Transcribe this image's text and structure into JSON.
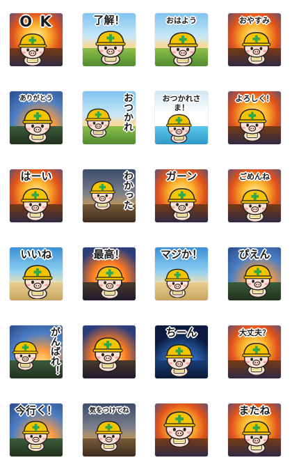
{
  "stickers": [
    {
      "caption": "O K",
      "scene": "fire"
    },
    {
      "caption": "了解！",
      "scene": "field"
    },
    {
      "caption": "おはよう",
      "scene": "field"
    },
    {
      "caption": "おやすみ",
      "scene": "fire"
    },
    {
      "caption": "ありがとう",
      "scene": "sky"
    },
    {
      "caption": "おつかれ",
      "scene": "field"
    },
    {
      "caption": "おつかれさま！",
      "scene": "pool"
    },
    {
      "caption": "よろしく！",
      "scene": "fire"
    },
    {
      "caption": "はーい",
      "scene": "fire"
    },
    {
      "caption": "わかった",
      "scene": "village"
    },
    {
      "caption": "ガーン",
      "scene": "fire"
    },
    {
      "caption": "ごめんね",
      "scene": "fire"
    },
    {
      "caption": "いいね",
      "scene": "beach"
    },
    {
      "caption": "最高！",
      "scene": "blast"
    },
    {
      "caption": "マジか！",
      "scene": "beach"
    },
    {
      "caption": "ぴえん",
      "scene": "sky"
    },
    {
      "caption": "がんばれ！",
      "scene": "sky"
    },
    {
      "caption": "",
      "scene": "blast"
    },
    {
      "caption": "ちーん",
      "scene": "space"
    },
    {
      "caption": "大丈夫？",
      "scene": "fire"
    },
    {
      "caption": "今行く！",
      "scene": "sky"
    },
    {
      "caption": "気をつけてね",
      "scene": "village"
    },
    {
      "caption": "",
      "scene": "fire"
    },
    {
      "caption": "またね",
      "scene": "fire"
    }
  ],
  "colors": {
    "helmet": "#f4c400",
    "cross": "#2fa84f",
    "skin": "#fbe2d4",
    "outline": "#222222"
  }
}
